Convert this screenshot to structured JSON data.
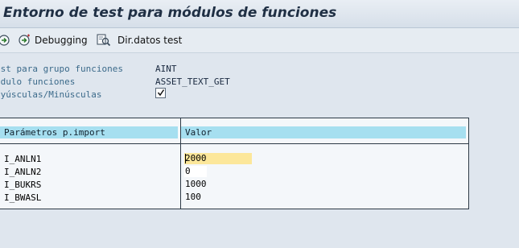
{
  "window": {
    "title": "Entorno de test para módulos de funciones",
    "accent": "#a6dff0",
    "highlight": "#fce79a"
  },
  "toolbar": {
    "execute_icon": "execute-icon",
    "debugging_label": "Debugging",
    "debugging_icon": "debug-execute-icon",
    "dirdatos_label": "Dir.datos test",
    "dirdatos_icon": "test-data-directory-icon"
  },
  "form": {
    "grupo_label": "est para grupo funciones",
    "grupo_value": "AINT",
    "modulo_label": "ódulo funciones",
    "modulo_value": "ASSET_TEXT_GET",
    "mayus_label": "ayúsculas/Minúsculas",
    "mayus_checked": true
  },
  "table": {
    "headers": [
      "Parámetros p.import",
      "Valor"
    ],
    "rows": [
      {
        "name": "I_ANLN1",
        "value": "2000"
      },
      {
        "name": "I_ANLN2",
        "value": "0"
      },
      {
        "name": "I_BUKRS",
        "value": "1000"
      },
      {
        "name": "I_BWASL",
        "value": "100"
      }
    ]
  }
}
